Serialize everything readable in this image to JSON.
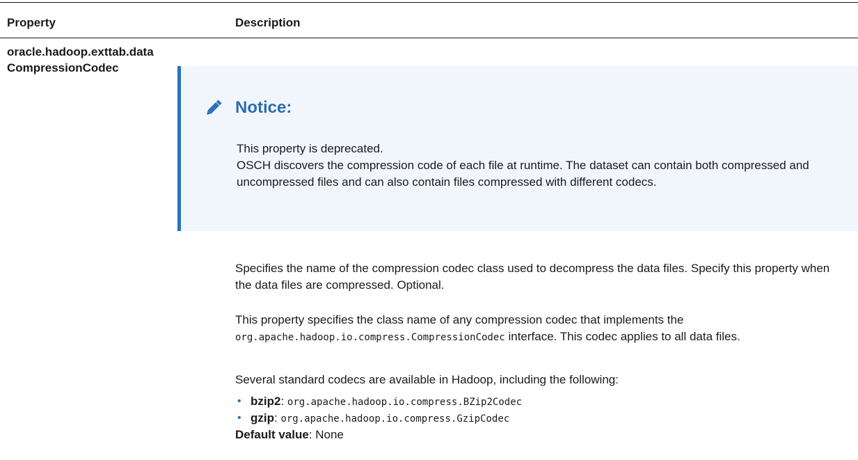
{
  "table": {
    "headers": {
      "property": "Property",
      "description": "Description"
    },
    "row": {
      "property_line1": "oracle.hadoop.exttab.data",
      "property_line2": "CompressionCodec",
      "notice": {
        "icon": "pencil-icon",
        "title": "Notice:",
        "line1": "This property is deprecated.",
        "line2": "OSCH discovers the compression code of each file at runtime. The dataset can contain both compressed and uncompressed files and can also contain files compressed with different codecs."
      },
      "paragraph1": "Specifies the name of the compression codec class used to decompress the data files. Specify this property when the data files are compressed. Optional.",
      "paragraph2_before": "This property specifies the class name of any compression codec that implements the ",
      "paragraph2_code": "org.apache.hadoop.io.compress.CompressionCodec",
      "paragraph2_after": " interface. This codec applies to all data files.",
      "paragraph3": "Several standard codecs are available in Hadoop, including the following:",
      "codecs": [
        {
          "name": "bzip2",
          "sep": ": ",
          "class": "org.apache.hadoop.io.compress.BZip2Codec"
        },
        {
          "name": "gzip",
          "sep": ": ",
          "class": "org.apache.hadoop.io.compress.GzipCodec"
        }
      ],
      "default_label": "Default value",
      "default_sep": ": ",
      "default_value": "None"
    }
  },
  "colors": {
    "accent": "#2b72b8",
    "notice_title": "#2b6cb0",
    "notice_bg": "#f1f6fc",
    "text": "#1a1a1a"
  }
}
